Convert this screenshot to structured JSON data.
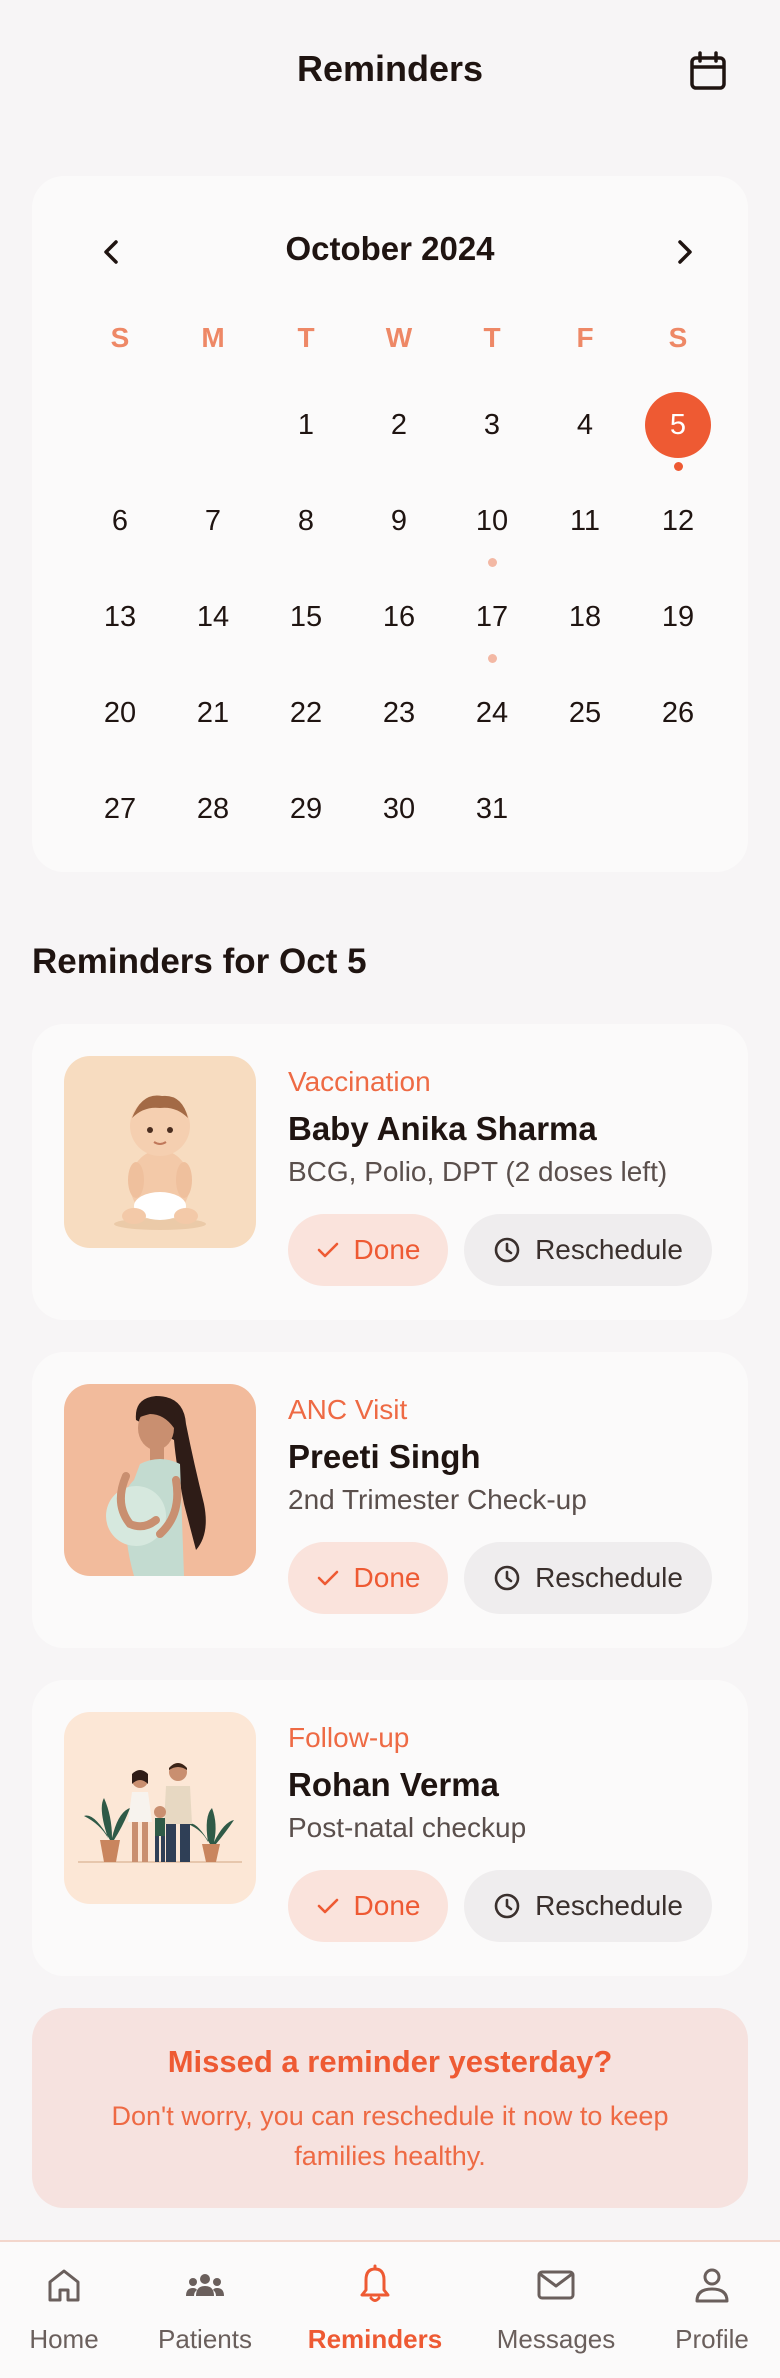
{
  "header": {
    "title": "Reminders",
    "calendar_icon": "calendar-icon"
  },
  "calendar": {
    "month_label": "October 2024",
    "weekday_labels": [
      "S",
      "M",
      "T",
      "W",
      "T",
      "F",
      "S"
    ],
    "selected_day": "5",
    "days": [
      "1",
      "2",
      "3",
      "4",
      "5",
      "6",
      "7",
      "8",
      "9",
      "10",
      "11",
      "12",
      "13",
      "14",
      "15",
      "16",
      "17",
      "18",
      "19",
      "20",
      "21",
      "22",
      "23",
      "24",
      "25",
      "26",
      "27",
      "28",
      "29",
      "30",
      "31"
    ],
    "days_with_reminders": [
      "5",
      "10",
      "17"
    ],
    "accent_color": "#ee5a33"
  },
  "section": {
    "title": "Reminders for Oct 5"
  },
  "reminders": [
    {
      "type": "Vaccination",
      "name": "Baby Anika Sharma",
      "detail": "BCG, Polio, DPT (2 doses left)",
      "done_label": "Done",
      "reschedule_label": "Reschedule"
    },
    {
      "type": "ANC Visit",
      "name": "Preeti Singh",
      "detail": "2nd Trimester Check-up",
      "done_label": "Done",
      "reschedule_label": "Reschedule"
    },
    {
      "type": "Follow-up",
      "name": "Rohan Verma",
      "detail": "Post-natal checkup",
      "done_label": "Done",
      "reschedule_label": "Reschedule"
    }
  ],
  "banner": {
    "title": "Missed a reminder yesterday?",
    "body": "Don't worry, you can reschedule it now to keep families healthy."
  },
  "nav": {
    "items": [
      {
        "label": "Home",
        "icon": "home-icon"
      },
      {
        "label": "Patients",
        "icon": "patients-icon"
      },
      {
        "label": "Reminders",
        "icon": "bell-icon"
      },
      {
        "label": "Messages",
        "icon": "mail-icon"
      },
      {
        "label": "Profile",
        "icon": "profile-icon"
      }
    ],
    "active": "Reminders"
  }
}
